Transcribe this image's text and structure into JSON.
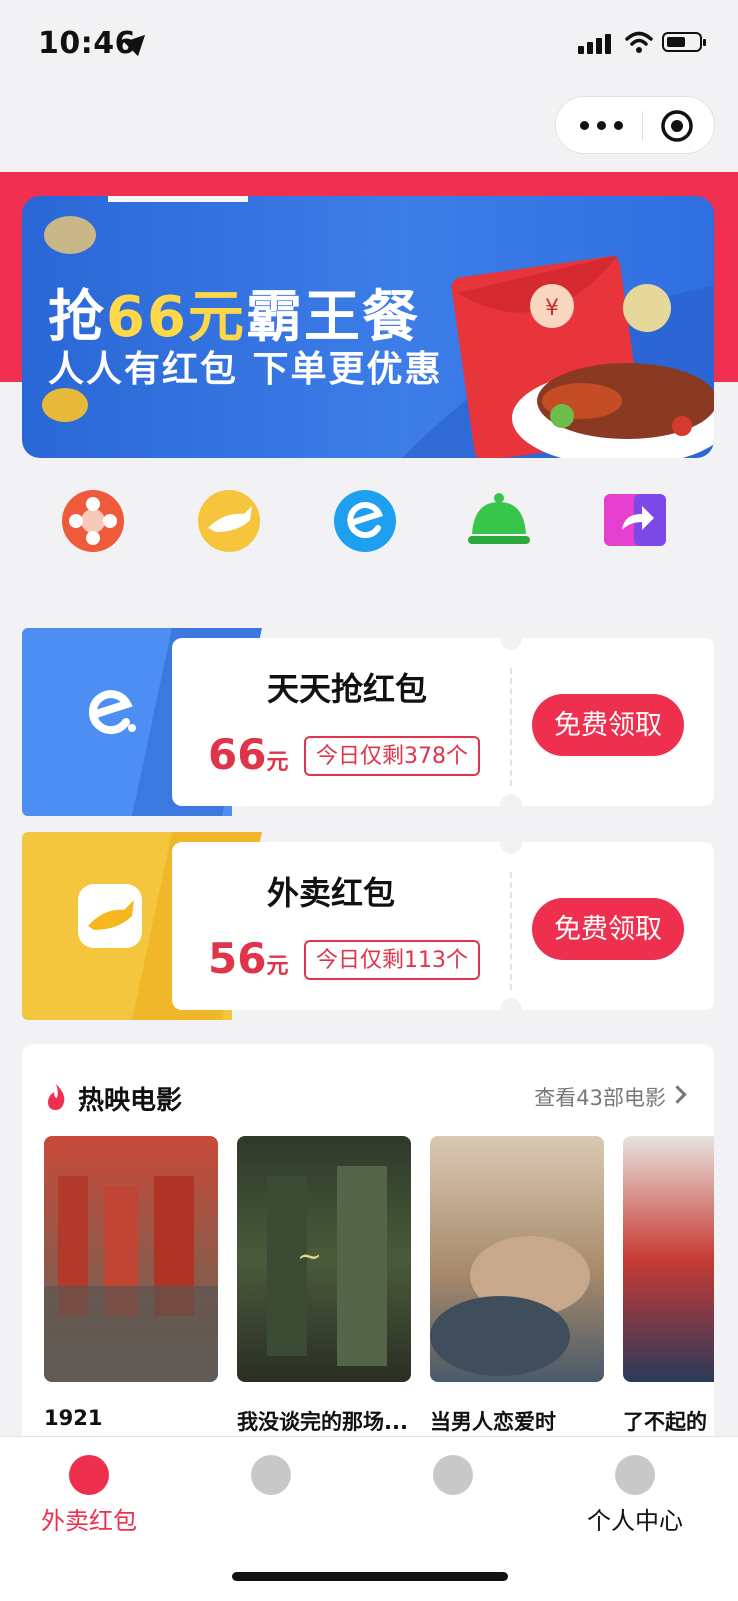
{
  "status_bar": {
    "time": "10:46"
  },
  "banner": {
    "title_prefix": "抢",
    "title_highlight": "66元",
    "title_suffix": "霸王餐",
    "subtitle": "人人有红包 下单更优惠",
    "page_count": 2,
    "active_page": 2
  },
  "quick_icons": [
    "movie-reel-icon",
    "kangaroo-icon",
    "eleme-icon",
    "food-cloche-icon",
    "share-ticket-icon"
  ],
  "coupons": [
    {
      "title": "天天抢红包",
      "amount": "66",
      "unit": "元",
      "stock": "今日仅剩378个",
      "button": "免费领取",
      "color": "#4d8ef2"
    },
    {
      "title": "外卖红包",
      "amount": "56",
      "unit": "元",
      "stock": "今日仅剩113个",
      "button": "免费领取",
      "color": "#f4c63d"
    }
  ],
  "movies": {
    "title": "热映电影",
    "more": "查看43部电影",
    "items": [
      {
        "name": "1921"
      },
      {
        "name": "我没谈完的那场..."
      },
      {
        "name": "当男人恋爱时"
      },
      {
        "name": "了不起的"
      }
    ]
  },
  "tabs": [
    {
      "label": "外卖红包",
      "active": true
    },
    {
      "label": "",
      "active": false
    },
    {
      "label": "",
      "active": false
    },
    {
      "label": "个人中心",
      "active": false
    }
  ],
  "colors": {
    "accent": "#ee2f4e",
    "banner_blue": "#2f6fe0",
    "highlight_yellow": "#ffd84a"
  }
}
